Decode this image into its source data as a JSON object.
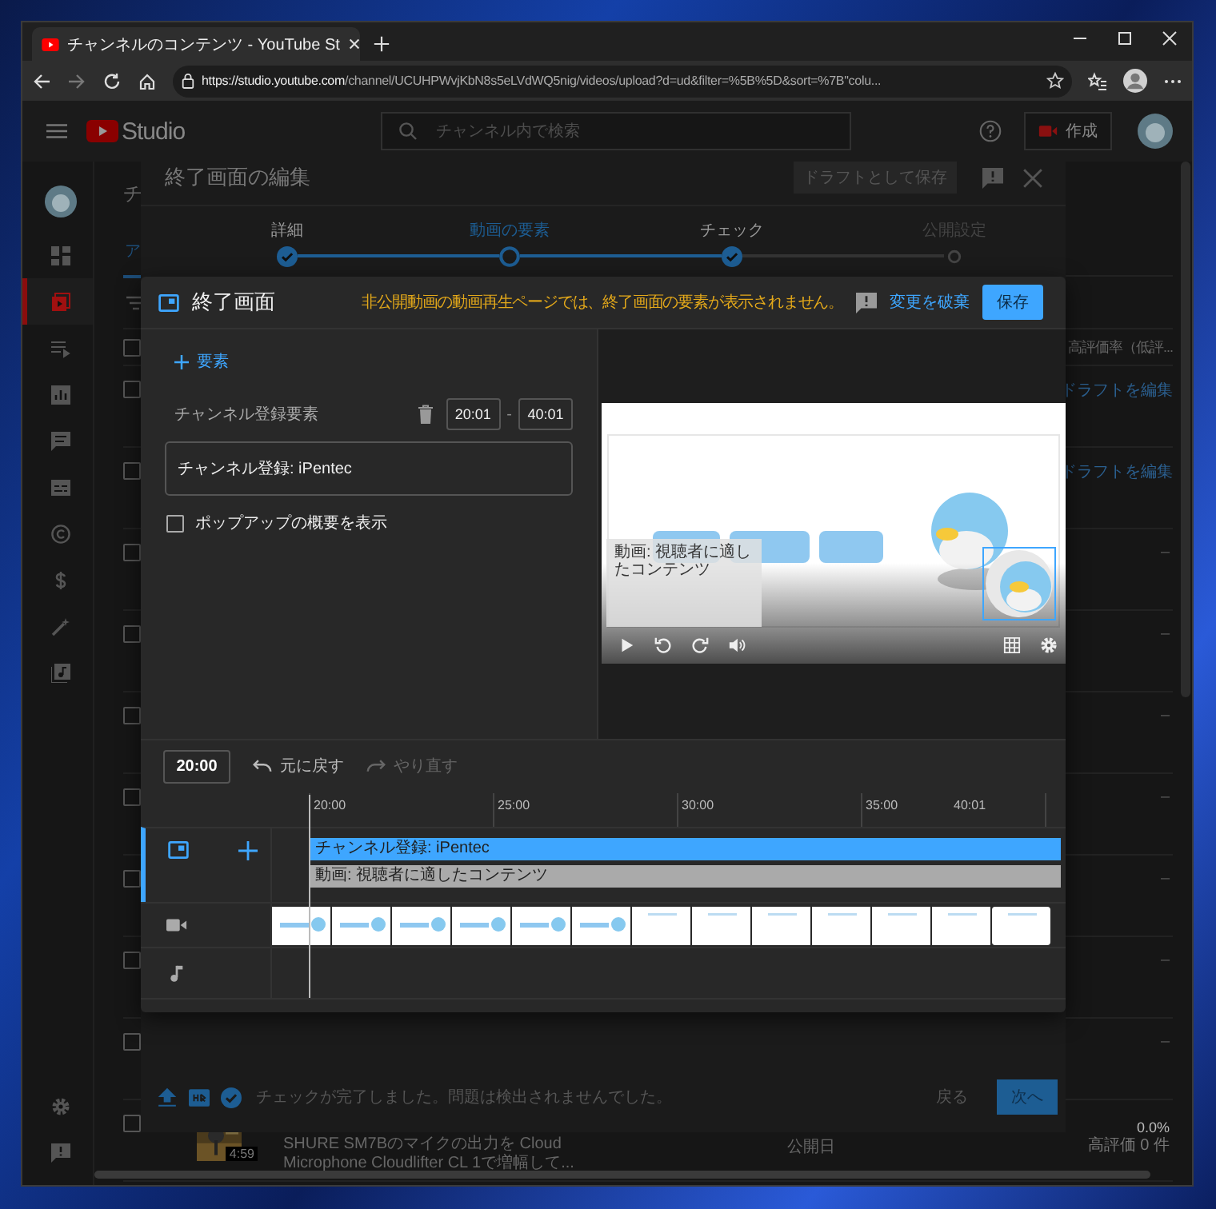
{
  "browser": {
    "tab": {
      "title": "チャンネルのコンテンツ - YouTube St"
    },
    "url": {
      "host": "https://studio.youtube.com",
      "path": "/channel/UCUHPWvjKbN8s5eLVdWQ5nig/videos/upload?d=ud&filter=%5B%5D&sort=%7B\"colu..."
    }
  },
  "studio": {
    "logo": "Studio",
    "search_placeholder": "チャンネル内で検索",
    "create_label": "作成",
    "sidebar": [
      {
        "kind": "avatar",
        "selected": false
      },
      {
        "kind": "dashboard",
        "selected": false
      },
      {
        "kind": "content",
        "selected": true
      },
      {
        "kind": "playlists",
        "selected": false
      },
      {
        "kind": "analytics",
        "selected": false
      },
      {
        "kind": "comments",
        "selected": false
      },
      {
        "kind": "subtitles",
        "selected": false
      },
      {
        "kind": "copyright",
        "selected": false
      },
      {
        "kind": "earn",
        "selected": false
      },
      {
        "kind": "customize",
        "selected": false
      },
      {
        "kind": "audio",
        "selected": false
      }
    ],
    "sidebar_bottom": [
      {
        "kind": "settings"
      },
      {
        "kind": "feedback"
      }
    ]
  },
  "page": {
    "title": "チ",
    "tab": "ア",
    "column_header": "高評価率（低評...",
    "select_all_checked": false,
    "rows": [
      {
        "kind": "draft",
        "checked": false,
        "status": "ドラフトを編集"
      },
      {
        "kind": "draft",
        "checked": false,
        "status": "ドラフトを編集"
      },
      {
        "kind": "plain",
        "checked": false,
        "status": "–"
      },
      {
        "kind": "plain",
        "checked": false,
        "status": "–"
      },
      {
        "kind": "plain",
        "checked": false,
        "status": "–"
      },
      {
        "kind": "plain",
        "checked": false,
        "status": "–"
      },
      {
        "kind": "plain",
        "checked": false,
        "status": "–"
      },
      {
        "kind": "plain",
        "checked": false,
        "status": "–"
      },
      {
        "kind": "plain",
        "checked": false,
        "status": "–"
      },
      {
        "kind": "video",
        "checked": false,
        "duration": "4:59",
        "title": "SHURE SM7Bのマイクの出力を Cloud Microphone Cloudlifter CL 1で増幅して...",
        "date": "公開日",
        "rating": "0.0%",
        "likes": "高評価 0 件"
      }
    ]
  },
  "upload_dialog": {
    "title": "終了画面の編集",
    "draft_button": "ドラフトとして保存",
    "steps": [
      {
        "label": "詳細",
        "completed": true,
        "selected": false
      },
      {
        "label": "動画の要素",
        "completed": false,
        "selected": true
      },
      {
        "label": "チェック",
        "completed": true,
        "selected": false
      },
      {
        "label": "公開設定",
        "completed": false,
        "selected": false
      }
    ],
    "footer": {
      "status": "チェックが完了しました。問題は検出されませんでした。",
      "back": "戻る",
      "next": "次へ"
    }
  },
  "endscreen_editor": {
    "title": "終了画面",
    "warning": "非公開動画の動画再生ページでは、終了画面の要素が表示されません。",
    "discard": "変更を破棄",
    "save": "保存",
    "add_element": "要素",
    "element": {
      "name": "チャンネル登録要素",
      "start": "20:01",
      "separator": "-",
      "end": "40:01",
      "channel": "チャンネル登録: iPentec",
      "popup_summary": {
        "label": "ポップアップの概要を表示",
        "checked": false
      }
    },
    "preview": {
      "overlay_card": "動画: 視聴者に適したコンテンツ"
    },
    "timeline": {
      "current_time": "20:00",
      "undo": {
        "label": "元に戻す",
        "disabled": false
      },
      "redo": {
        "label": "やり直す",
        "disabled": true
      },
      "ticks": [
        "20:00",
        "25:00",
        "30:00",
        "35:00",
        "40:01"
      ],
      "bars": [
        {
          "label": "チャンネル登録: iPentec",
          "color": "#3ea6ff"
        },
        {
          "label": "動画: 視聴者に適したコンテンツ",
          "color": "#aaaaaa"
        }
      ]
    }
  }
}
